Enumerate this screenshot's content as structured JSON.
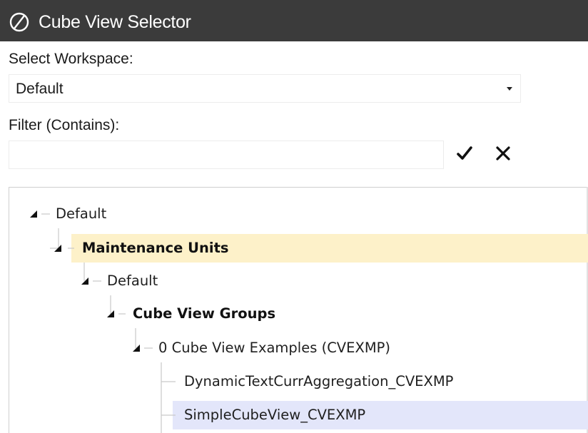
{
  "window": {
    "title": "Cube View Selector",
    "title_icon": "onestream-logo-icon"
  },
  "workspace": {
    "label": "Select Workspace:",
    "selected": "Default",
    "caret_icon": "dropdown-arrow-icon"
  },
  "filter": {
    "label": "Filter (Contains):",
    "value": "",
    "placeholder": "",
    "apply_icon": "checkmark-icon",
    "clear_icon": "close-icon"
  },
  "tree": {
    "nodes": [
      {
        "label": "Default",
        "level": 0,
        "expanded": true,
        "bold": false,
        "highlight": "none"
      },
      {
        "label": "Maintenance Units",
        "level": 1,
        "expanded": true,
        "bold": true,
        "highlight": "selected-yellow"
      },
      {
        "label": "Default",
        "level": 2,
        "expanded": true,
        "bold": false,
        "highlight": "none"
      },
      {
        "label": "Cube View Groups",
        "level": 3,
        "expanded": true,
        "bold": true,
        "highlight": "none"
      },
      {
        "label": "0 Cube View Examples (CVEXMP)",
        "level": 4,
        "expanded": true,
        "bold": false,
        "highlight": "none"
      },
      {
        "label": "DynamicTextCurrAggregation_CVEXMP",
        "level": 5,
        "leaf": true,
        "bold": false,
        "highlight": "none"
      },
      {
        "label": "SimpleCubeView_CVEXMP",
        "level": 5,
        "leaf": true,
        "bold": false,
        "highlight": "hover-blue"
      }
    ]
  },
  "colors": {
    "titlebar": "#3b3b3b",
    "selected_row": "#fdf1c9",
    "hover_row": "#e3e6fa"
  }
}
